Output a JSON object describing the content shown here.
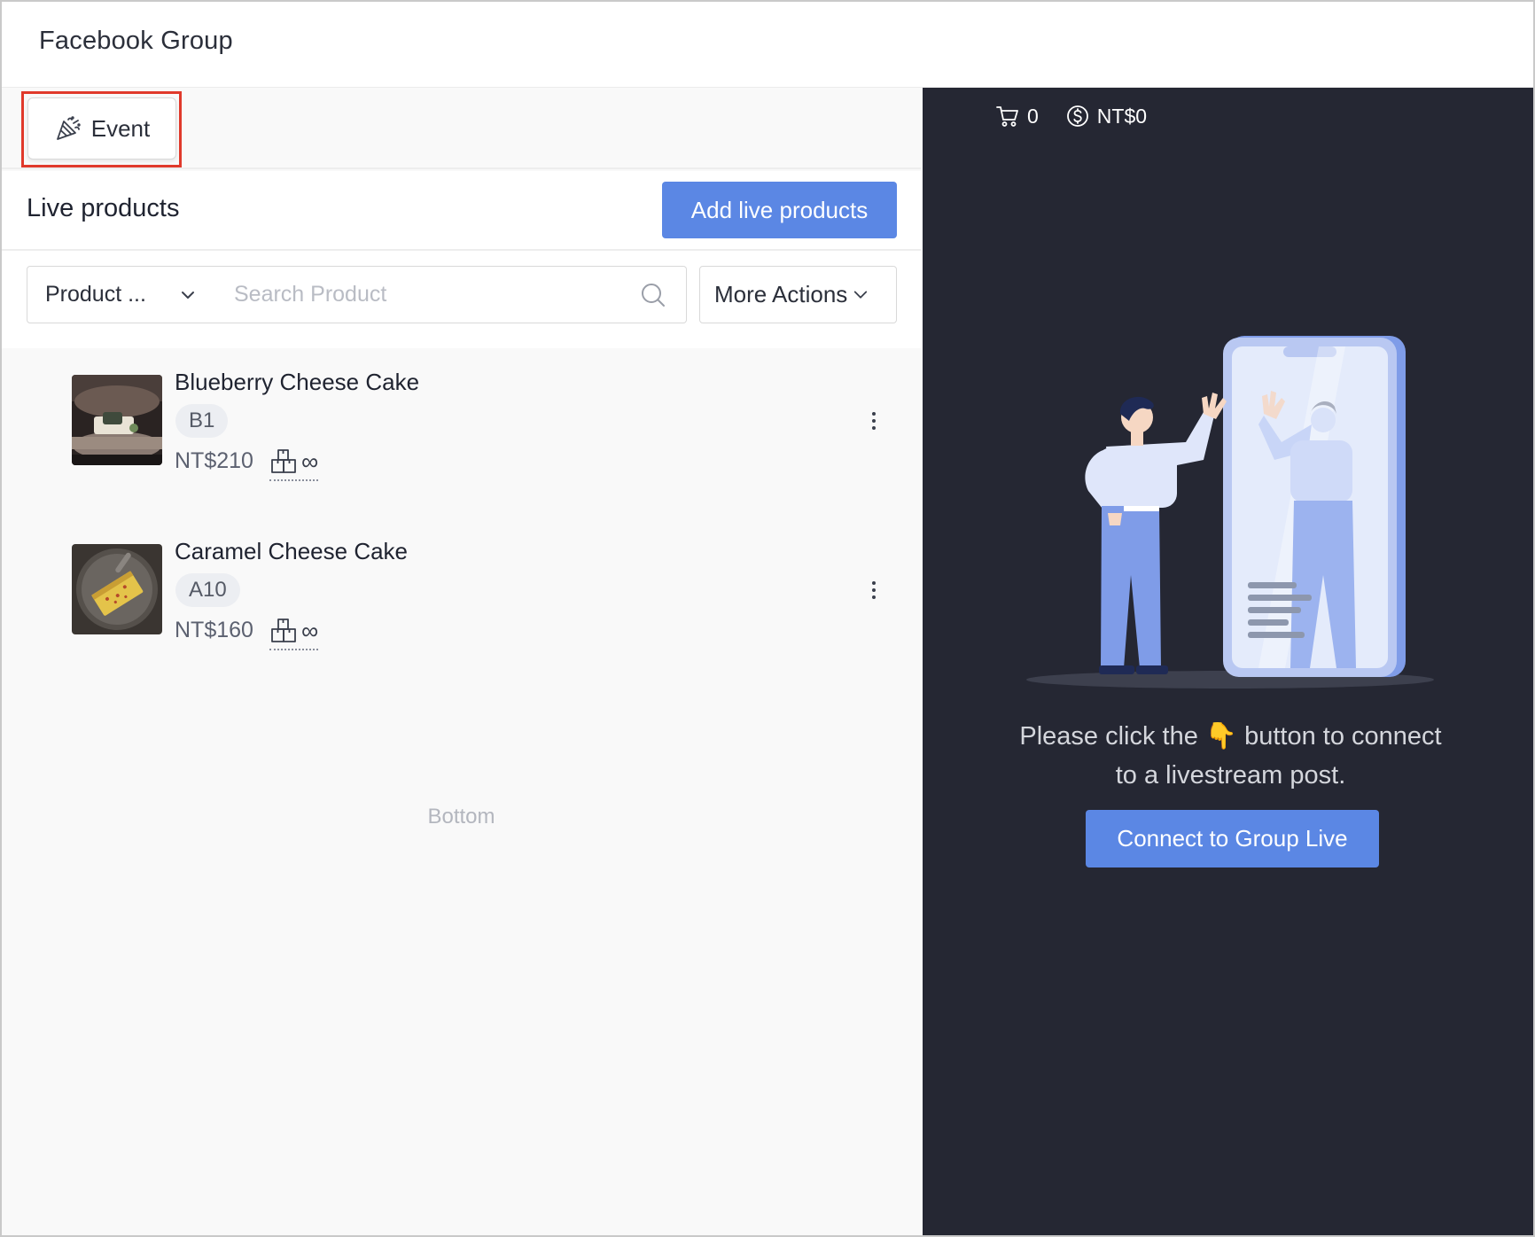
{
  "header": {
    "title": "Facebook Group"
  },
  "toolbar": {
    "event_label": "Event"
  },
  "live": {
    "title": "Live products",
    "add_button_label": "Add live products"
  },
  "filters": {
    "product_select_value": "Product ...",
    "search_placeholder": "Search Product",
    "more_actions_label": "More Actions"
  },
  "products": [
    {
      "name": "Blueberry Cheese Cake",
      "code": "B1",
      "price": "NT$210",
      "stock": "∞"
    },
    {
      "name": "Caramel Cheese Cake",
      "code": "A10",
      "price": "NT$160",
      "stock": "∞"
    }
  ],
  "list_footer": "Bottom",
  "stats": {
    "cart_count": "0",
    "revenue": "NT$0"
  },
  "connect": {
    "prompt_line1": "Please click the 👇 button to connect",
    "prompt_line2": "to a livestream post.",
    "button_label": "Connect to Group Live"
  },
  "colors": {
    "accent": "#5b87e4",
    "highlight": "#e0392b",
    "dark_panel": "#252733"
  },
  "icons": [
    "event-icon",
    "chevron-down-icon",
    "search-icon",
    "stock-icon",
    "kebab-icon",
    "cart-icon",
    "dollar-icon"
  ]
}
